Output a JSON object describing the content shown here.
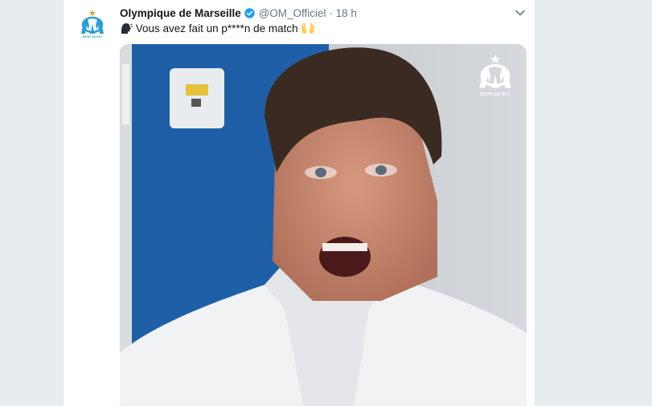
{
  "tweet": {
    "author_name": "Olympique de Marseille",
    "handle": "@OM_Officiel",
    "separator": "·",
    "time": "18 h",
    "text": "Vous avez fait un p****n de match",
    "leading_emoji": "speaking-head-icon",
    "trailing_emoji": "raised-hands-icon",
    "avatar_tagline": "DROIT AU BUT",
    "watermark_tagline": "DROIT AU BUT"
  },
  "colors": {
    "background": "#e6ecf0",
    "card": "#ffffff",
    "verified": "#1da1f2",
    "om_blue": "#2a9fd6",
    "meta_text": "#657786",
    "primary_text": "#14171a"
  },
  "icons": {
    "verified": "verified-badge-icon",
    "caret": "chevron-down-icon",
    "avatar": "om-logo-icon",
    "watermark": "om-logo-watermark"
  }
}
